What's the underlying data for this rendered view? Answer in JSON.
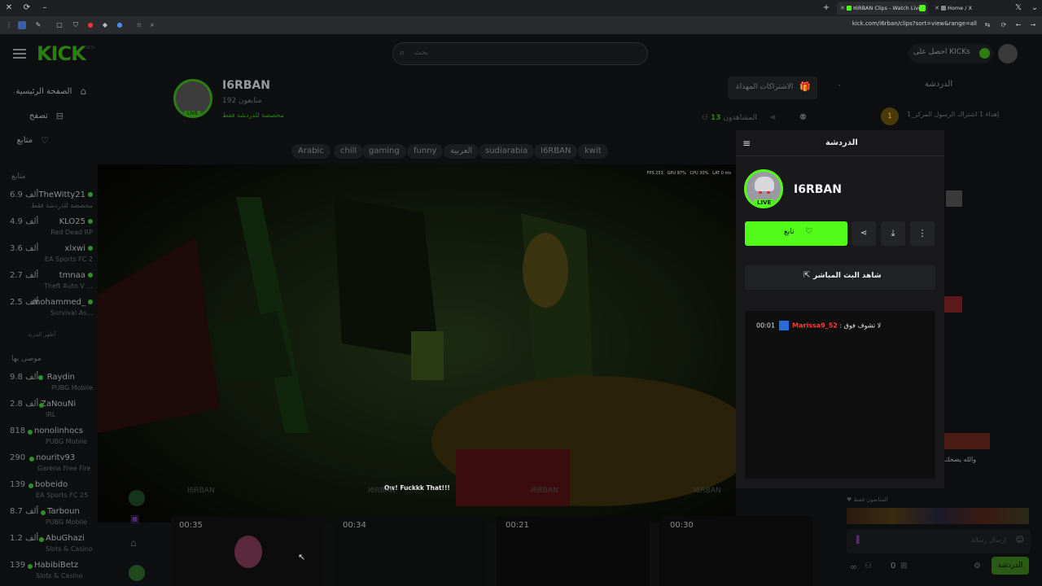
{
  "browser": {
    "tabs": [
      {
        "title": "I6RBAN Clips - Watch Live",
        "active": true
      },
      {
        "title": "Home / X",
        "active": false
      }
    ],
    "url": "kick.com/i6rban/clips?sort=view&range=all"
  },
  "header": {
    "logo": "KICK",
    "logo_badge": "BETA",
    "search_placeholder": "بحث",
    "get_kicks": "احصل على KICKs"
  },
  "sidebar": {
    "nav": [
      {
        "label": "الصفحة الرئيسية",
        "icon": "home-icon"
      },
      {
        "label": "تصفح",
        "icon": "browse-icon"
      },
      {
        "label": "متابع",
        "icon": "heart-icon"
      }
    ],
    "following_heading": "متابع",
    "following": [
      {
        "name": "TheWitty21",
        "viewers": "6.9 ألف",
        "game": "مخصصة للدردشة فقط"
      },
      {
        "name": "KLO25",
        "viewers": "4.9 ألف",
        "game": "Red Dead RP"
      },
      {
        "name": "xlxwi",
        "viewers": "3.6 ألف",
        "game": "EA Sports FC 2"
      },
      {
        "name": "tmnaa",
        "viewers": "2.7 ألف",
        "game": "Theft Auto V ..."
      },
      {
        "name": "mohammed_",
        "viewers": "2.5 ألف",
        "game": "Survival As..."
      }
    ],
    "show_more": "أظهر المزيد",
    "recommended_heading": "موصى بها",
    "recommended": [
      {
        "name": "Raydin",
        "viewers": "9.8 ألف",
        "game": "PUBG Mobile"
      },
      {
        "name": "ZaNouNi",
        "viewers": "2.8 ألف",
        "game": "IRL"
      },
      {
        "name": "nonolinhocs",
        "viewers": "818",
        "game": "PUBG Mobile"
      },
      {
        "name": "nouritv93",
        "viewers": "290",
        "game": "Garena Free Fire"
      },
      {
        "name": "bobeido",
        "viewers": "139",
        "game": "EA Sports FC 25"
      },
      {
        "name": "Tarboun",
        "viewers": "8.7 ألف",
        "game": "PUBG Mobile"
      },
      {
        "name": "AbuGhazi",
        "viewers": "1.2 ألف",
        "game": "Slots & Casino"
      },
      {
        "name": "HabibiBetz",
        "viewers": "139",
        "game": "Slots & Casino"
      }
    ]
  },
  "channel": {
    "name": "I6RBAN",
    "followers": "192 متابعون",
    "category": "مخصصة للدردشة فقط",
    "tags": [
      "Arabic",
      "chill",
      "gaming",
      "funny",
      "العربية",
      "sudiarabia",
      "I6RBAN",
      "kwit"
    ],
    "gift_subs": "الاشتراكات المهداة",
    "viewers_label": "المشاهدون",
    "viewers": "13"
  },
  "video": {
    "overlay_stats": [
      "FPS 253",
      "GPU 97%",
      "CPU 30%",
      "LAT 0 ms"
    ],
    "caption": "Ow! Fuckkk That!!!"
  },
  "clips_row": {
    "labels": [
      "I6RBAN",
      "I6RBAN",
      "I6RBAN",
      "I6RBAN"
    ],
    "durations": [
      "00:35",
      "00:34",
      "00:21",
      "00:30"
    ]
  },
  "modal": {
    "title": "الدردشة",
    "channel_name": "I6RBAN",
    "live_badge": "LIVE",
    "follow_label": "تابع",
    "watch_live_label": "شاهد البث المباشر",
    "chat_message": {
      "time": "00:01",
      "user": "Marissa9_52",
      "separator": ":",
      "text": "لا تشوف فوق"
    }
  },
  "right_chat": {
    "title": "الدردشة",
    "pinned": "إهداء 1 اشتراك الرسول المركز_1",
    "pinned_count": "1",
    "message_placeholder": "إرسال رسالة",
    "send_label": "الدردشة",
    "points": "0",
    "followers_only": "المتابعون فقط",
    "side_text": "والله يضحك"
  },
  "colors": {
    "kick_green": "#53fc18",
    "username_red": "#ff3b3b",
    "accent_dim": "#2b7d14"
  }
}
